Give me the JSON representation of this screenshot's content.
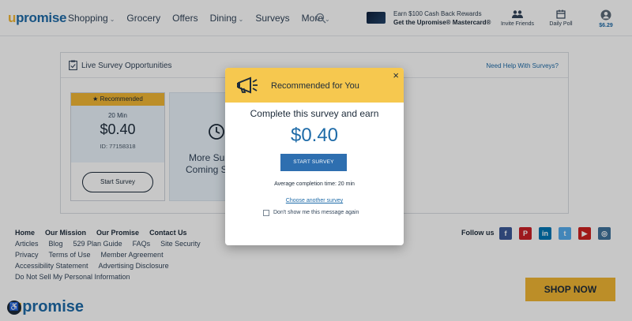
{
  "header": {
    "logo": {
      "u": "u",
      "rest": "promise"
    },
    "nav": [
      {
        "label": "Shopping",
        "caret": true
      },
      {
        "label": "Grocery",
        "caret": false
      },
      {
        "label": "Offers",
        "caret": false
      },
      {
        "label": "Dining",
        "caret": true
      },
      {
        "label": "Surveys",
        "caret": false
      },
      {
        "label": "More",
        "caret": true
      }
    ],
    "promo_line1": "Earn $100 Cash Back Rewards",
    "promo_line2": "Get the Upromise® Mastercard®",
    "invite_label": "Invite Friends",
    "poll_label": "Daily Poll",
    "balance": "$6.29"
  },
  "panel": {
    "title": "Live Survey Opportunities",
    "help_link": "Need Help With Surveys?",
    "card1": {
      "badge": "Recommended",
      "minutes": "20 Min",
      "amount": "$0.40",
      "id": "ID: 77158318",
      "button": "Start Survey"
    },
    "card2": {
      "line1": "More Sur",
      "line2": "Coming S"
    }
  },
  "footer": {
    "heads": [
      "Home",
      "Our Mission",
      "Our Promise",
      "Contact Us"
    ],
    "row1": [
      "Articles",
      "Blog",
      "529 Plan Guide",
      "FAQs",
      "Site Security"
    ],
    "row2": [
      "Privacy",
      "Terms of Use",
      "Member Agreement"
    ],
    "row3": [
      "Accessibility Statement",
      "Advertising Disclosure"
    ],
    "row4": [
      "Do Not Sell My Personal Information"
    ],
    "follow": "Follow us",
    "socials": [
      {
        "name": "facebook",
        "glyph": "f",
        "color": "#3b5998"
      },
      {
        "name": "pinterest",
        "glyph": "P",
        "color": "#cb2027"
      },
      {
        "name": "linkedin",
        "glyph": "in",
        "color": "#0077b5"
      },
      {
        "name": "twitter",
        "glyph": "t",
        "color": "#55acee"
      },
      {
        "name": "youtube",
        "glyph": "▶",
        "color": "#cd201f"
      },
      {
        "name": "instagram",
        "glyph": "◎",
        "color": "#3f729b"
      }
    ],
    "shop_now": "SHOP NOW",
    "logo": {
      "u": "u",
      "rest": "promise"
    }
  },
  "modal": {
    "title": "Recommended for You",
    "close": "×",
    "subtitle": "Complete this survey and earn",
    "amount": "$0.40",
    "button": "START SURVEY",
    "avg": "Average completion time: 20 min",
    "link": "Choose another survey",
    "checkbox_label": "Don't show me this message again"
  },
  "colors": {
    "brand_blue": "#1e6ba8",
    "brand_gold": "#f1b634",
    "modal_header": "#f6c84f",
    "button_blue": "#2e6fb0"
  }
}
